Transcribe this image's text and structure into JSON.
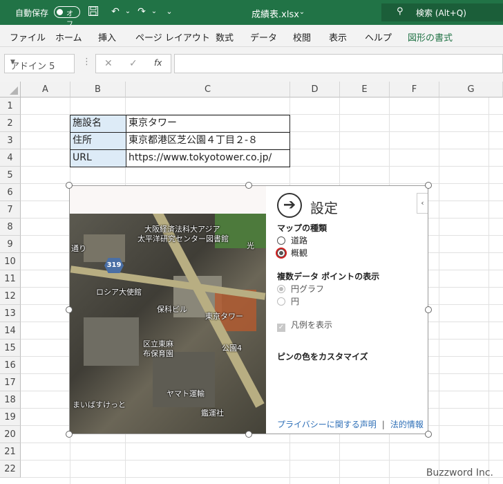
{
  "titlebar": {
    "autosave_label": "自動保存",
    "toggle_state": "オフ",
    "filename": "成績表.xlsx",
    "search_label": "検索 (Alt+Q)",
    "colors": {
      "brand": "#217346"
    }
  },
  "menu": {
    "items": [
      "ファイル",
      "ホーム",
      "挿入",
      "ページ レイアウト",
      "数式",
      "データ",
      "校閲",
      "表示",
      "ヘルプ",
      "図形の書式"
    ],
    "active_item": "図形の書式"
  },
  "formula_bar": {
    "name_box": "アドイン 5",
    "cancel": "✕",
    "enter": "✓",
    "fx": "fx",
    "content": ""
  },
  "grid": {
    "columns": [
      "A",
      "B",
      "C",
      "D",
      "E",
      "F",
      "G"
    ],
    "rows": [
      "1",
      "2",
      "3",
      "4",
      "5",
      "6",
      "7",
      "8",
      "9",
      "10",
      "11",
      "12",
      "13",
      "14",
      "15",
      "16",
      "17",
      "18",
      "19",
      "20",
      "21",
      "22"
    ]
  },
  "table": {
    "rows": [
      {
        "label": "施設名",
        "value": "東京タワー"
      },
      {
        "label": "住所",
        "value": "東京都港区芝公園４丁目２-８"
      },
      {
        "label": "URL",
        "value": "https://www.tokyotower.co.jp/"
      }
    ]
  },
  "map": {
    "labels": [
      "大阪経済法科大アジア",
      "太平洋研究センター図書館",
      "通り",
      "319",
      "ロシア大使館",
      "保科ビル",
      "東京タワー",
      "区立東麻",
      "布保育園",
      "公園4",
      "ヤマト運輸",
      "まいばすけっと",
      "鑑運社",
      "光"
    ]
  },
  "panel": {
    "title": "設定",
    "map_type_heading": "マップの種類",
    "map_type_options": [
      "道路",
      "概観"
    ],
    "map_type_selected": "概観",
    "multi_heading": "複数データ ポイントの表示",
    "multi_options": [
      "円グラフ",
      "円"
    ],
    "legend_label": "凡例を表示",
    "pin_color_label": "ピンの色をカスタマイズ",
    "privacy_link": "プライバシーに関する声明",
    "separator": "|",
    "legal_link": "法的情報",
    "collapse": "‹"
  },
  "watermark": "Buzzword Inc."
}
